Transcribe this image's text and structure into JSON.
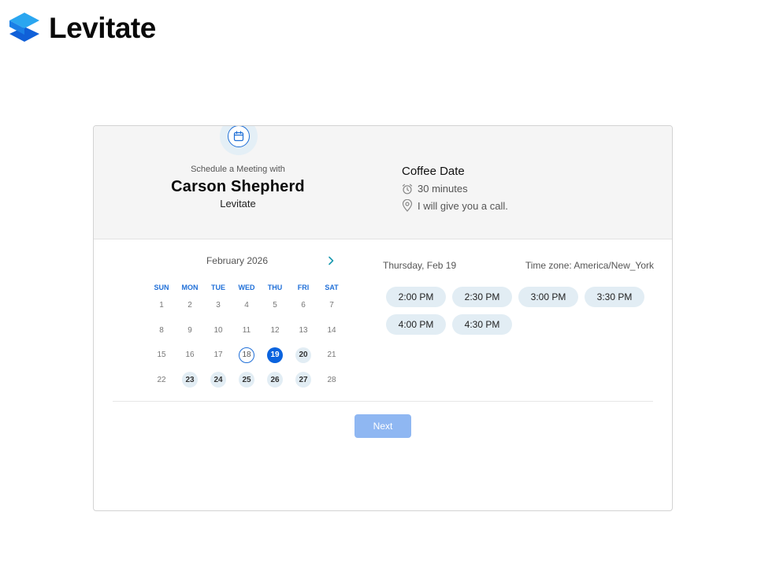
{
  "brand": {
    "name": "Levitate",
    "colors": {
      "accent": "#0a63de",
      "logo_top": "#2aa6f0",
      "logo_bottom": "#1060d8"
    }
  },
  "header": {
    "subtitle": "Schedule a Meeting with",
    "host_name": "Carson Shepherd",
    "host_org": "Levitate",
    "icon": "calendar-icon"
  },
  "event": {
    "title": "Coffee Date",
    "duration": "30 minutes",
    "location": "I will give you a call."
  },
  "calendar": {
    "month_label": "February 2026",
    "weekdays": [
      "SUN",
      "MON",
      "TUE",
      "WED",
      "THU",
      "FRI",
      "SAT"
    ],
    "today": 18,
    "selected": 19,
    "available": [
      19,
      20,
      23,
      24,
      25,
      26,
      27
    ],
    "weeks": [
      [
        1,
        2,
        3,
        4,
        5,
        6,
        7
      ],
      [
        8,
        9,
        10,
        11,
        12,
        13,
        14
      ],
      [
        15,
        16,
        17,
        18,
        19,
        20,
        21
      ],
      [
        22,
        23,
        24,
        25,
        26,
        27,
        28
      ]
    ]
  },
  "slots": {
    "date_label": "Thursday, Feb 19",
    "timezone_label": "Time zone: America/New_York",
    "times": [
      "2:00 PM",
      "2:30 PM",
      "3:00 PM",
      "3:30 PM",
      "4:00 PM",
      "4:30 PM"
    ]
  },
  "footer": {
    "next_label": "Next"
  }
}
